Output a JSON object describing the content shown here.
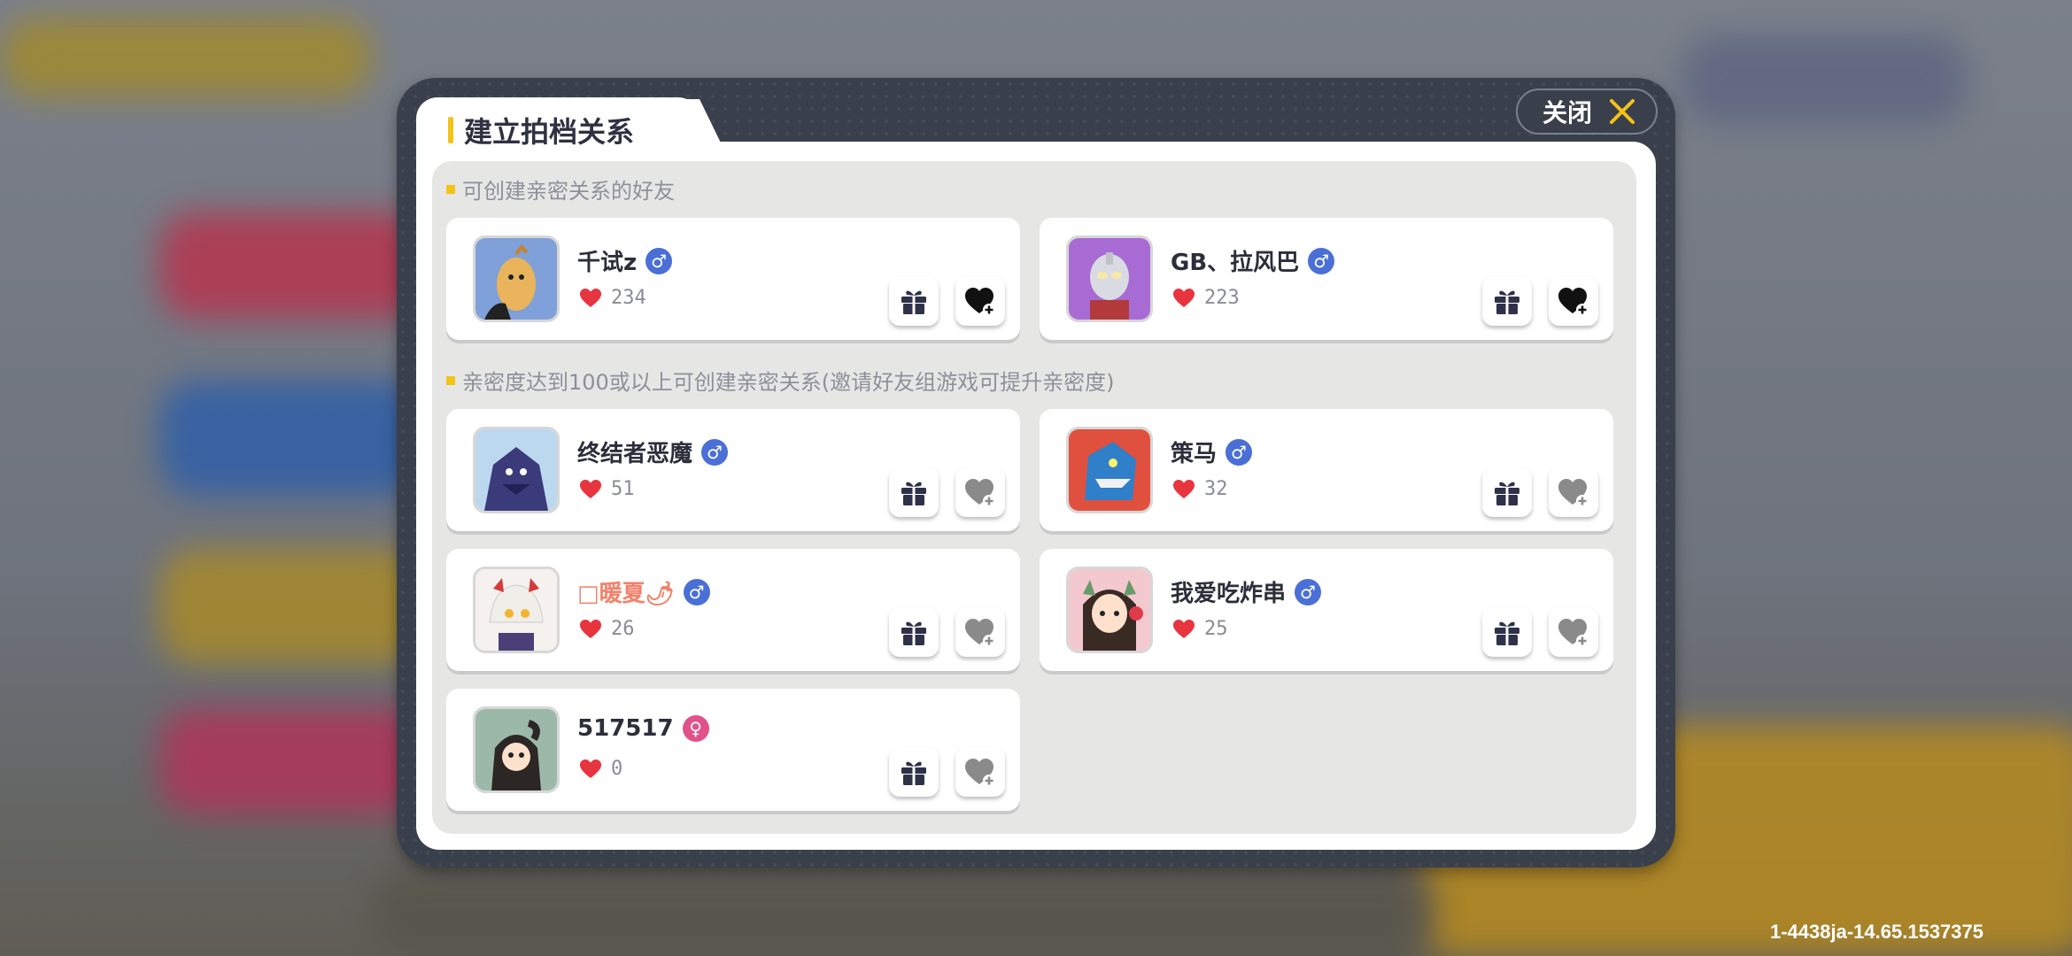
{
  "modal": {
    "title": "建立拍档关系",
    "close_label": "关闭"
  },
  "sections": [
    {
      "label": "可创建亲密关系的好友"
    },
    {
      "label": "亲密度达到100或以上可创建亲密关系(邀请好友组游戏可提升亲密度)"
    }
  ],
  "friends": [
    {
      "name": "千试z",
      "gender": "male",
      "affinity": "234",
      "can_bond": true
    },
    {
      "name": "GB、拉风巴",
      "gender": "male",
      "affinity": "223",
      "can_bond": true
    },
    {
      "name": "终结者恶魔",
      "gender": "male",
      "affinity": "51",
      "can_bond": false
    },
    {
      "name": "策马",
      "gender": "male",
      "affinity": "32",
      "can_bond": false
    },
    {
      "name": "□暖夏🌶",
      "gender": "male",
      "affinity": "26",
      "can_bond": false
    },
    {
      "name": "我爱吃炸串",
      "gender": "male",
      "affinity": "25",
      "can_bond": false
    },
    {
      "name": "517517",
      "gender": "female",
      "affinity": "0",
      "can_bond": false
    }
  ],
  "gender_symbols": {
    "male": "♂",
    "female": "♀"
  },
  "version_text": "1-4438ja-14.65.1537375",
  "colors": {
    "accent_yellow": "#f3c318",
    "male_badge": "#4a6fd6",
    "female_badge": "#e2528a",
    "heart_red": "#e8343e",
    "bond_enabled": "#111111",
    "bond_disabled": "#8a8a8a",
    "pink_name": "#f2816a"
  }
}
